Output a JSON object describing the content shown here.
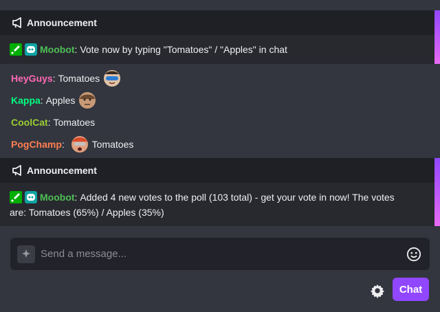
{
  "announcements": [
    {
      "header": "Announcement",
      "user": "Moobot",
      "sep": ":",
      "text": "Vote now by typing \"Tomatoes\" / \"Apples\" in chat"
    },
    {
      "header": "Announcement",
      "user": "Moobot",
      "sep": ":",
      "line1": "Added 4 new votes to the poll (103 total) - get your vote in now! The votes",
      "line2": "are: Tomatoes (65%) / Apples (35%)"
    }
  ],
  "messages": [
    {
      "user": "HeyGuys",
      "sep": ":",
      "text": "Tomatoes",
      "emote": "heyguys-emote"
    },
    {
      "user": "Kappa",
      "sep": ":",
      "text": "Apples",
      "emote": "kappa-emote"
    },
    {
      "user": "CoolCat",
      "sep": ":",
      "text": "Tomatoes"
    },
    {
      "user": "PogChamp",
      "sep": ":",
      "text": "Tomatoes",
      "emote": "pogchamp-emote"
    }
  ],
  "input": {
    "placeholder": "Send a message..."
  },
  "chat_button": "Chat",
  "icons": {
    "announcement": "megaphone-icon",
    "mod_badge": "sword-icon",
    "bot_badge": "robot-icon",
    "input_left": "sparkle-icon",
    "emoji": "smiley-icon",
    "settings": "gear-icon"
  },
  "colors": {
    "accent": "#9147ff",
    "heyguys": "#ff69b4",
    "kappa": "#00ff7f",
    "coolcat": "#9acd32",
    "pogchamp": "#ff7f50",
    "moobot": "#4ebf56"
  }
}
